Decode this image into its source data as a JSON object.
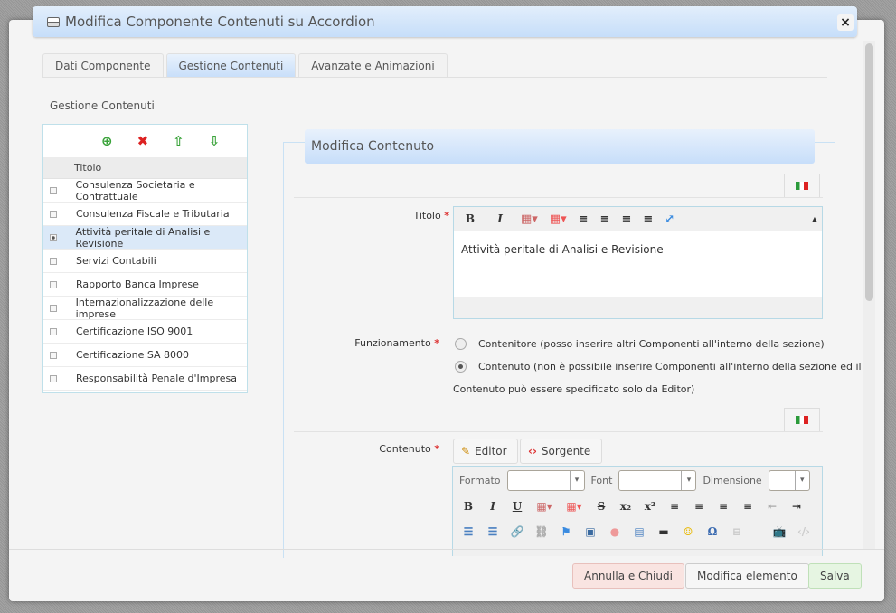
{
  "dialog": {
    "title": "Modifica Componente Contenuti su Accordion",
    "close": "×"
  },
  "tabs": [
    {
      "label": "Dati Componente"
    },
    {
      "label": "Gestione Contenuti",
      "active": true
    },
    {
      "label": "Avanzate e Animazioni"
    }
  ],
  "section_title": "Gestione Contenuti",
  "list": {
    "toolbar": {
      "add": "⊕",
      "delete": "✖",
      "up": "⇧",
      "down": "⇩"
    },
    "column": "Titolo",
    "items": [
      "Consulenza Societaria e Contrattuale",
      "Consulenza Fiscale e Tributaria",
      "Attività peritale di Analisi e Revisione",
      "Servizi Contabili",
      "Rapporto Banca Imprese",
      "Internazionalizzazione delle imprese",
      "Certificazione ISO 9001",
      "Certificazione SA 8000",
      "Responsabilità Penale d'Impresa"
    ],
    "selected_index": 2
  },
  "form": {
    "header": "Modifica Contenuto",
    "required_mark": "*",
    "titolo_label": "Titolo",
    "titolo_value": "Attività peritale di Analisi e Revisione",
    "funzionamento_label": "Funzionamento",
    "options": [
      "Contenitore (posso inserire altri Componenti all'interno della sezione)",
      "Contenuto (non è possibile inserire Componenti all'interno della sezione ed il",
      "Contenuto può essere specificato solo da Editor)"
    ],
    "selected_option": 1,
    "contenuto_label": "Contenuto",
    "editor_tab": "Editor",
    "source_tab": "Sorgente",
    "formato": "Formato",
    "font": "Font",
    "dimensione": "Dimensione"
  },
  "footer": {
    "cancel": "Annulla e Chiudi",
    "modify": "Modifica elemento",
    "save": "Salva"
  },
  "colors": {
    "title_bar": "#c7defa",
    "save": "#e6f5e2",
    "cancel": "#f9e4e1"
  }
}
